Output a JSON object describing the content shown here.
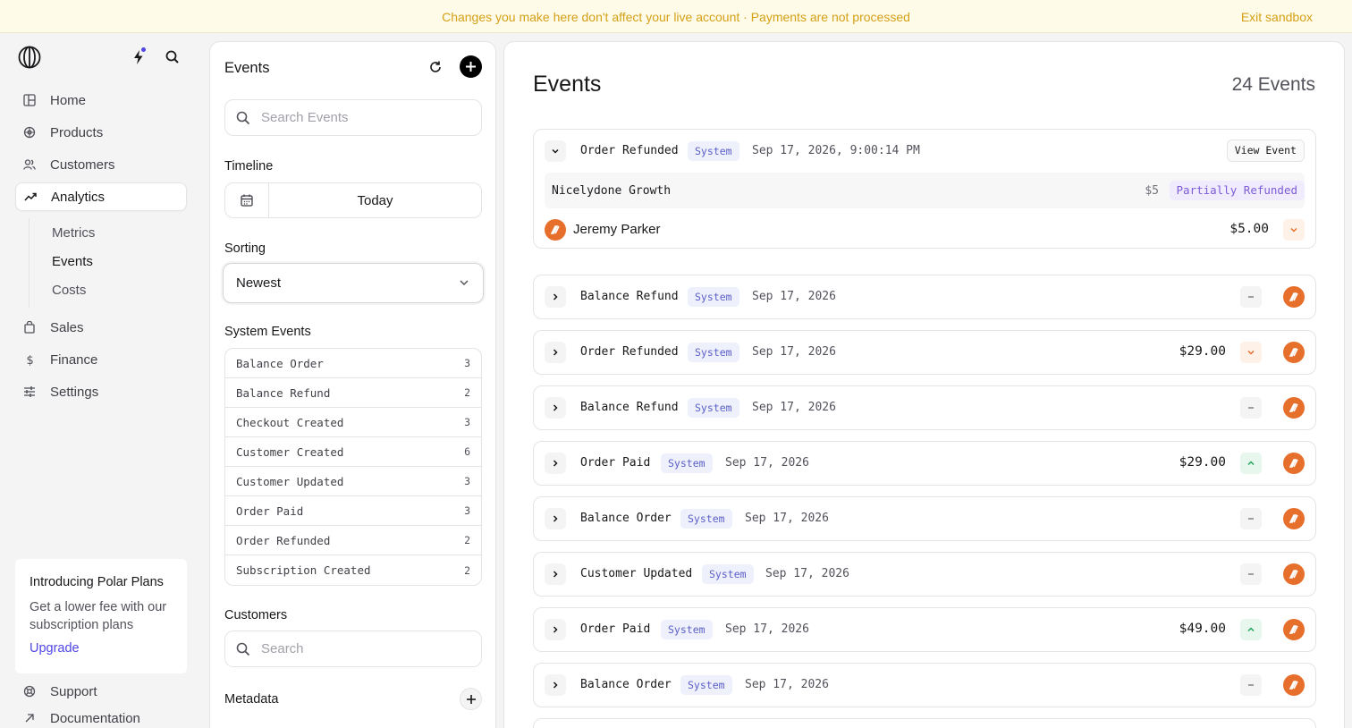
{
  "banner": {
    "message": "Changes you make here don't affect your live account · Payments are not processed",
    "exit": "Exit sandbox"
  },
  "sidebar": {
    "nav": [
      {
        "label": "Home",
        "icon": "grid-icon"
      },
      {
        "label": "Products",
        "icon": "box-icon"
      },
      {
        "label": "Customers",
        "icon": "users-icon"
      },
      {
        "label": "Analytics",
        "icon": "trend-icon",
        "active": true
      }
    ],
    "sub": [
      {
        "label": "Metrics"
      },
      {
        "label": "Events",
        "active": true
      },
      {
        "label": "Costs"
      }
    ],
    "nav2": [
      {
        "label": "Sales",
        "icon": "bag-icon"
      },
      {
        "label": "Finance",
        "icon": "dollar-icon"
      },
      {
        "label": "Settings",
        "icon": "sliders-icon"
      }
    ],
    "promo": {
      "title": "Introducing Polar Plans",
      "text": "Get a lower fee with our subscription plans",
      "link": "Upgrade"
    },
    "footer": [
      {
        "label": "Support",
        "icon": "lifebuoy-icon"
      },
      {
        "label": "Documentation",
        "icon": "arrow-up-right-icon"
      }
    ]
  },
  "filters": {
    "title": "Events",
    "search_placeholder": "Search Events",
    "timeline_label": "Timeline",
    "timeline_value": "Today",
    "sorting_label": "Sorting",
    "sorting_value": "Newest",
    "system_events_label": "System Events",
    "system_events": [
      {
        "name": "Balance Order",
        "count": "3"
      },
      {
        "name": "Balance Refund",
        "count": "2"
      },
      {
        "name": "Checkout Created",
        "count": "3"
      },
      {
        "name": "Customer Created",
        "count": "6"
      },
      {
        "name": "Customer Updated",
        "count": "3"
      },
      {
        "name": "Order Paid",
        "count": "3"
      },
      {
        "name": "Order Refunded",
        "count": "2"
      },
      {
        "name": "Subscription Created",
        "count": "2"
      }
    ],
    "customers_label": "Customers",
    "customers_placeholder": "Search",
    "metadata_label": "Metadata"
  },
  "main": {
    "title": "Events",
    "count": "24 Events",
    "expanded": {
      "name": "Order Refunded",
      "badge": "System",
      "date": "Sep 17, 2026, 9:00:14 PM",
      "view_button": "View Event",
      "product": "Nicelydone Growth",
      "product_amount": "$5",
      "product_status": "Partially Refunded",
      "customer": "Jeremy Parker",
      "customer_amount": "$5.00"
    },
    "events": [
      {
        "name": "Balance Refund",
        "badge": "System",
        "date": "Sep 17, 2026",
        "amount": "",
        "trend": "none"
      },
      {
        "name": "Order Refunded",
        "badge": "System",
        "date": "Sep 17, 2026",
        "amount": "$29.00",
        "trend": "down"
      },
      {
        "name": "Balance Refund",
        "badge": "System",
        "date": "Sep 17, 2026",
        "amount": "",
        "trend": "none"
      },
      {
        "name": "Order Paid",
        "badge": "System",
        "date": "Sep 17, 2026",
        "amount": "$29.00",
        "trend": "up"
      },
      {
        "name": "Balance Order",
        "badge": "System",
        "date": "Sep 17, 2026",
        "amount": "",
        "trend": "none"
      },
      {
        "name": "Customer Updated",
        "badge": "System",
        "date": "Sep 17, 2026",
        "amount": "",
        "trend": "none"
      },
      {
        "name": "Order Paid",
        "badge": "System",
        "date": "Sep 17, 2026",
        "amount": "$49.00",
        "trend": "up"
      },
      {
        "name": "Balance Order",
        "badge": "System",
        "date": "Sep 17, 2026",
        "amount": "",
        "trend": "none"
      }
    ]
  },
  "colors": {
    "accent": "#4f46e5",
    "banner_text": "#d4a017",
    "avatar": "#e76f2c",
    "badge_bg": "#eef0fb",
    "badge_text": "#5b5fc7"
  }
}
